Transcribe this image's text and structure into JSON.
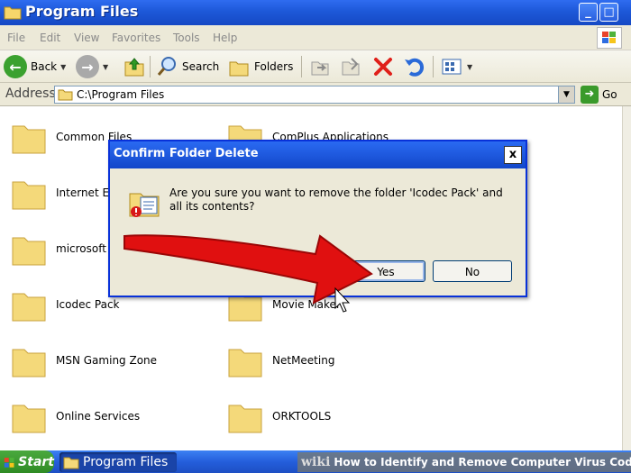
{
  "window": {
    "title": "Program Files",
    "controls": {
      "minimize": "_",
      "maximize": "□"
    }
  },
  "menu": [
    "File",
    "Edit",
    "View",
    "Favorites",
    "Tools",
    "Help"
  ],
  "toolbar": {
    "back_label": "Back",
    "search_label": "Search",
    "folders_label": "Folders"
  },
  "address": {
    "label": "Address",
    "value": "C:\\Program Files",
    "go_label": "Go"
  },
  "folders": [
    "Common Files",
    "ComPlus Applications",
    "Internet E",
    "",
    "microsoft f",
    "",
    "Icodec Pack",
    "Movie Maker",
    "MSN Gaming Zone",
    "NetMeeting",
    "Online Services",
    "ORKTOOLS"
  ],
  "dialog": {
    "title": "Confirm Folder Delete",
    "close": "x",
    "message": "Are you sure you want to remove the folder 'Icodec Pack' and all its contents?",
    "yes_label": "Yes",
    "no_label": "No"
  },
  "taskbar": {
    "start_label": "Start",
    "window_label": "Program Files"
  },
  "watermark": {
    "brand": "wiki",
    "text": "How to Identify and Remove Computer Virus Codec"
  },
  "colors": {
    "titlebar": "#1d58d8",
    "arrow": "#e01010",
    "folder": "#f4d97a"
  }
}
